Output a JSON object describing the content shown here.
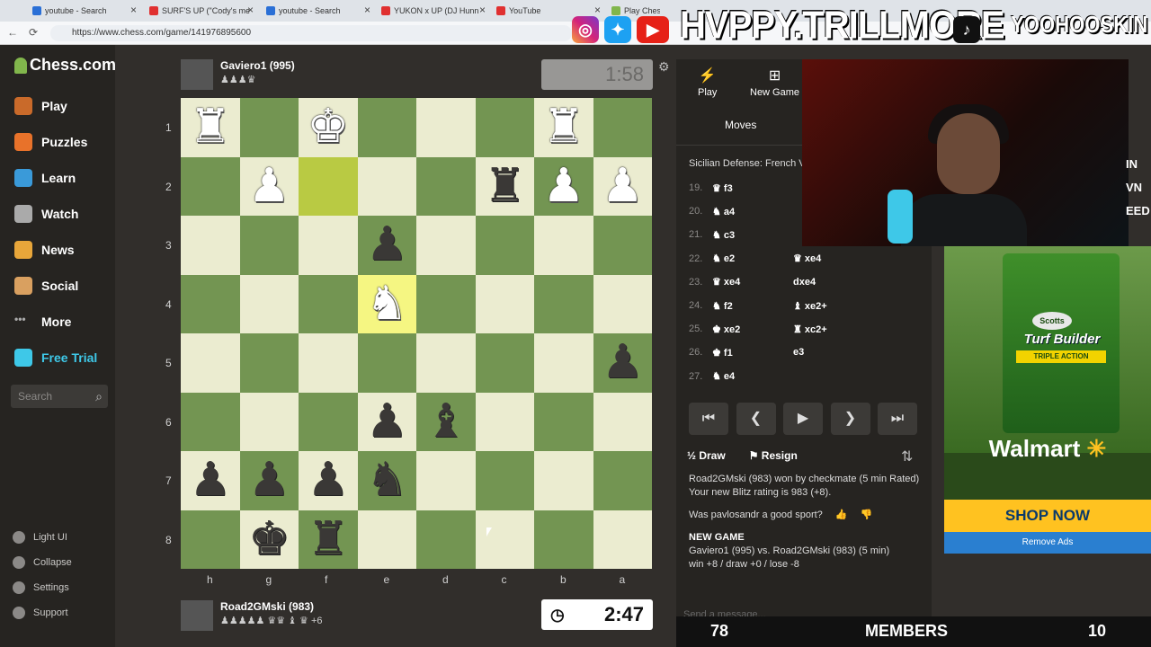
{
  "browser": {
    "tabs": [
      {
        "title": "youtube - Search",
        "fav": "#2a6fd6"
      },
      {
        "title": "SURF'S UP (\"Cody's me",
        "fav": "#e03030"
      },
      {
        "title": "youtube - Search",
        "fav": "#2a6fd6"
      },
      {
        "title": "YUKON x UP (DJ Hunn",
        "fav": "#e03030"
      },
      {
        "title": "YouTube",
        "fav": "#e03030"
      },
      {
        "title": "Play Chess Onli",
        "fav": "#81b64c"
      }
    ],
    "url": "https://www.chess.com/game/141976895600"
  },
  "sidebar": {
    "brand": "Chess.com",
    "items": [
      {
        "label": "Play",
        "color": "#c96a2a"
      },
      {
        "label": "Puzzles",
        "color": "#e8722a"
      },
      {
        "label": "Learn",
        "color": "#3a9ad9"
      },
      {
        "label": "Watch",
        "color": "#aaaaaa"
      },
      {
        "label": "News",
        "color": "#e8a63a"
      },
      {
        "label": "Social",
        "color": "#d9a060"
      },
      {
        "label": "More",
        "color": "#aaaaaa"
      },
      {
        "label": "Free Trial",
        "color": "#3ec8e8"
      }
    ],
    "search_placeholder": "Search",
    "bottom": [
      {
        "label": "Light UI"
      },
      {
        "label": "Collapse"
      },
      {
        "label": "Settings"
      },
      {
        "label": "Support"
      }
    ]
  },
  "top_player": {
    "name": "Gaviero1 (995)",
    "captured": "♟♟♟♛",
    "clock": "1:58"
  },
  "bottom_player": {
    "name": "Road2GMski (983)",
    "captured": "♟♟♟♟♟ ♛♛ ♝ ♛  +6",
    "clock": "2:47"
  },
  "board": {
    "ranks": [
      "1",
      "2",
      "3",
      "4",
      "5",
      "6",
      "7",
      "8"
    ],
    "files": [
      "h",
      "g",
      "f",
      "e",
      "d",
      "c",
      "b",
      "a"
    ],
    "light": "#ebecd0",
    "dark": "#739552",
    "highlight_light": "#f5f682",
    "highlight_dark": "#b9ca43",
    "highlights": [
      [
        1,
        2
      ],
      [
        3,
        3
      ]
    ],
    "pieces": [
      {
        "r": 0,
        "c": 0,
        "g": "♜",
        "s": "w"
      },
      {
        "r": 0,
        "c": 2,
        "g": "♚",
        "s": "w"
      },
      {
        "r": 0,
        "c": 6,
        "g": "♜",
        "s": "w"
      },
      {
        "r": 1,
        "c": 1,
        "g": "♟",
        "s": "w"
      },
      {
        "r": 1,
        "c": 5,
        "g": "♜",
        "s": "b"
      },
      {
        "r": 1,
        "c": 6,
        "g": "♟",
        "s": "w"
      },
      {
        "r": 1,
        "c": 7,
        "g": "♟",
        "s": "w"
      },
      {
        "r": 2,
        "c": 3,
        "g": "♟",
        "s": "b"
      },
      {
        "r": 3,
        "c": 3,
        "g": "♞",
        "s": "w"
      },
      {
        "r": 4,
        "c": 7,
        "g": "♟",
        "s": "b"
      },
      {
        "r": 5,
        "c": 3,
        "g": "♟",
        "s": "b"
      },
      {
        "r": 5,
        "c": 4,
        "g": "♝",
        "s": "b"
      },
      {
        "r": 6,
        "c": 0,
        "g": "♟",
        "s": "b"
      },
      {
        "r": 6,
        "c": 1,
        "g": "♟",
        "s": "b"
      },
      {
        "r": 6,
        "c": 2,
        "g": "♟",
        "s": "b"
      },
      {
        "r": 6,
        "c": 3,
        "g": "♞",
        "s": "b"
      },
      {
        "r": 7,
        "c": 1,
        "g": "♚",
        "s": "b"
      },
      {
        "r": 7,
        "c": 2,
        "g": "♜",
        "s": "b"
      }
    ]
  },
  "panel": {
    "tab_play": "Play",
    "tab_new": "New Game",
    "tab_moves": "Moves",
    "opening": "Sicilian Defense: French V",
    "moves": [
      {
        "n": "19.",
        "w": "♛ f3",
        "b": ""
      },
      {
        "n": "20.",
        "w": "♞ a4",
        "b": ""
      },
      {
        "n": "21.",
        "w": "♞ c3",
        "b": ""
      },
      {
        "n": "22.",
        "w": "♞ e2",
        "b": "♛ xe4"
      },
      {
        "n": "23.",
        "w": "♛ xe4",
        "b": "dxe4"
      },
      {
        "n": "24.",
        "w": "♞ f2",
        "b": "♝ xe2+"
      },
      {
        "n": "25.",
        "w": "♚ xe2",
        "b": "♜ xc2+"
      },
      {
        "n": "26.",
        "w": "♚ f1",
        "b": "e3"
      },
      {
        "n": "27.",
        "w": "♞ e4",
        "b": ""
      }
    ],
    "controls": [
      "⏮",
      "❮",
      "▶",
      "❯",
      "⏭"
    ],
    "draw": "½ Draw",
    "resign": "Resign",
    "chat": {
      "result": "Road2GMski (983) won by checkmate (5 min Rated)",
      "rating": "Your new Blitz rating is 983 (+8).",
      "sport": "Was pavlosandr a good sport?",
      "new_game_hdr": "NEW GAME",
      "new_game": "Gaviero1 (995) vs. Road2GMski (983) (5 min)",
      "record": "win +8 / draw +0 / lose -8"
    },
    "msg_placeholder": "Send a message..."
  },
  "overlay": {
    "brand": "HVPPY.TRILLMORE",
    "handle": "YOOHOOSKIN",
    "side_text": "IN\nVN\nEED",
    "members_left": "78",
    "members_label": "MEMBERS",
    "members_right": "10"
  },
  "ad": {
    "brand": "Scotts",
    "product": "Turf Builder",
    "tagline": "TRIPLE ACTION",
    "retailer": "Walmart",
    "cta": "SHOP NOW",
    "remove": "Remove Ads"
  }
}
